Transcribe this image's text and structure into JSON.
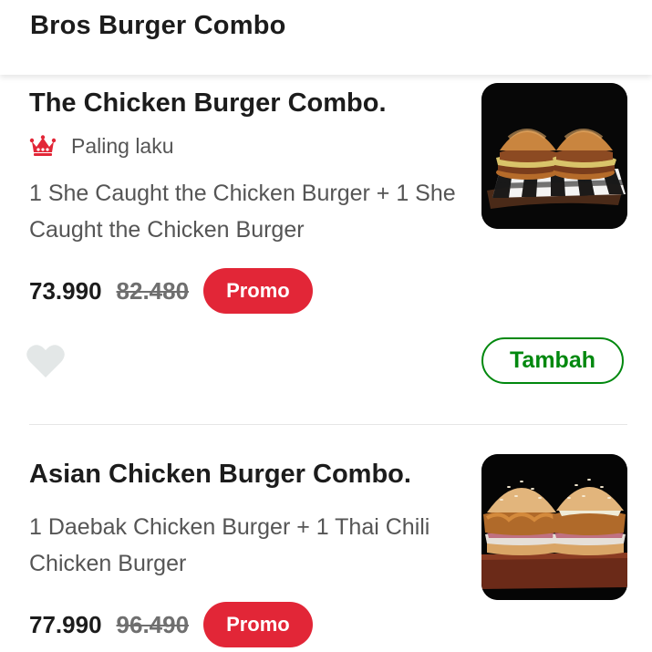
{
  "header": {
    "title": "Bros Burger Combo"
  },
  "items": [
    {
      "title": "The Chicken Burger Combo.",
      "badge": {
        "icon": "crown-icon",
        "label": "Paling laku",
        "color": "#e22637"
      },
      "description": "1 She Caught the Chicken Burger + 1 She Caught the Chicken Burger",
      "price": "73.990",
      "original_price": "82.480",
      "promo_label": "Promo",
      "favorite_icon": "heart-icon",
      "add_label": "Tambah"
    },
    {
      "title": "Asian Chicken Burger Combo.",
      "description": "1 Daebak Chicken Burger + 1 Thai Chili Chicken Burger",
      "price": "77.990",
      "original_price": "96.490",
      "promo_label": "Promo"
    }
  ],
  "colors": {
    "promo": "#e22637",
    "add_button": "#00880e",
    "heart_inactive": "#e3e7e7",
    "text_primary": "#1c1c1c",
    "text_secondary": "#555555"
  }
}
